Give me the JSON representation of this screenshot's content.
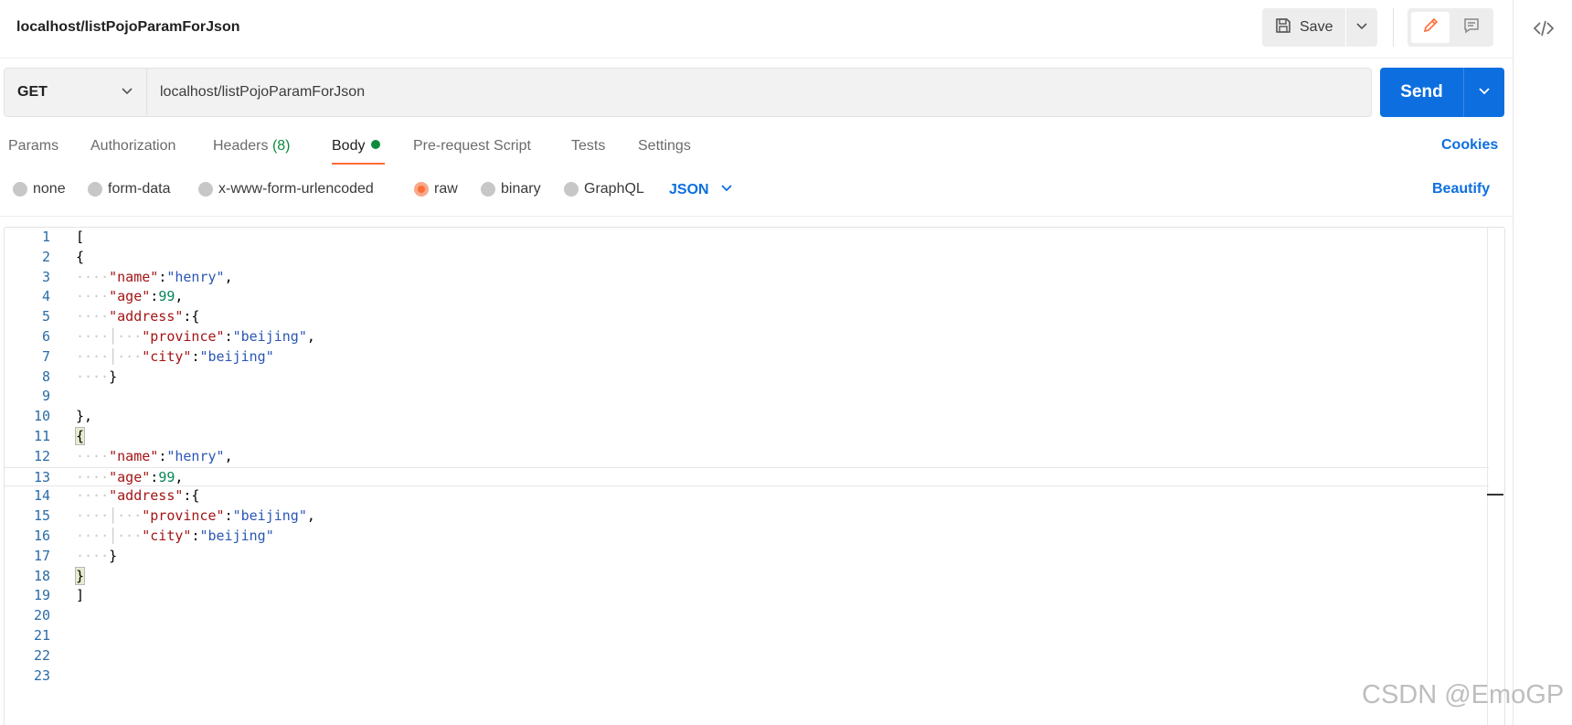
{
  "header": {
    "title": "localhost/listPojoParamForJson",
    "save_label": "Save"
  },
  "request": {
    "method": "GET",
    "url": "localhost/listPojoParamForJson",
    "send_label": "Send"
  },
  "tabs": {
    "params": "Params",
    "authorization": "Authorization",
    "headers": "Headers",
    "headers_count": "(8)",
    "body": "Body",
    "prerequest": "Pre-request Script",
    "tests": "Tests",
    "settings": "Settings",
    "cookies": "Cookies"
  },
  "body_types": {
    "none": "none",
    "form_data": "form-data",
    "urlencoded": "x-www-form-urlencoded",
    "raw": "raw",
    "binary": "binary",
    "graphql": "GraphQL",
    "language": "JSON",
    "beautify": "Beautify",
    "selected": "raw"
  },
  "editor": {
    "line_numbers": [
      "1",
      "2",
      "3",
      "4",
      "5",
      "6",
      "7",
      "8",
      "9",
      "10",
      "11",
      "12",
      "13",
      "14",
      "15",
      "16",
      "17",
      "18",
      "19",
      "20",
      "21",
      "22",
      "23"
    ],
    "current_line": 13
  },
  "watermark": "CSDN @EmoGP",
  "colors": {
    "accent": "#ff6c37",
    "send": "#0d6fdf",
    "success": "#0e8a3c"
  }
}
